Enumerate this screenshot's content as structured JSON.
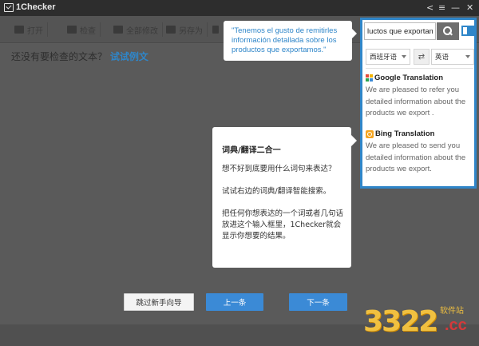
{
  "app": {
    "title": "1Checker"
  },
  "titlebar": {
    "share_glyph": "<",
    "menu_glyph": "≡",
    "minimize_glyph": "—",
    "close_glyph": "✕"
  },
  "toolbar": {
    "items": [
      {
        "label": "打开",
        "icon": "folder-icon"
      },
      {
        "label": "检查",
        "icon": "search-icon"
      },
      {
        "label": "全部修改",
        "icon": "edit-icon"
      },
      {
        "label": "另存为",
        "icon": "save-icon"
      },
      {
        "label": "",
        "icon": "document-icon"
      }
    ]
  },
  "main": {
    "prompt_text": "还没有要检查的文本？",
    "prompt_link": "试试例文"
  },
  "quote_bubble": {
    "text": "\"Tenemos el gusto de remitirles información detallada sobre los productos que exportamos.\""
  },
  "tour": {
    "heading": "词典/翻译二合一",
    "para1": "想不好到底要用什么词句来表达？",
    "para2": "试试右边的词典/翻译智能搜索。",
    "para3": "把任何你想表达的一个词或者几句话放进这个输入框里，1Checker就会显示你想要的结果。",
    "skip_label": "跳过新手向导",
    "prev_label": "上一条",
    "next_label": "下一条"
  },
  "translate_panel": {
    "search_value": "luctos que exportamos.",
    "source_lang": "西班牙语",
    "swap_glyph": "⇄",
    "target_lang": "英语",
    "engines": [
      {
        "name": "Google Translation",
        "icon": "google-icon",
        "text": "We are pleased to refer you detailed information about the products we export ."
      },
      {
        "name": "Bing Translation",
        "icon": "bing-icon",
        "text": "We are pleased to send you detailed information about the products we export."
      }
    ]
  },
  "watermark": {
    "number": "3322",
    "subtitle": "软件站",
    "domain": ".cc"
  },
  "colors": {
    "accent": "#2f86c9",
    "button_blue": "#3b8ad6",
    "titlebar": "#2d2d2d"
  }
}
